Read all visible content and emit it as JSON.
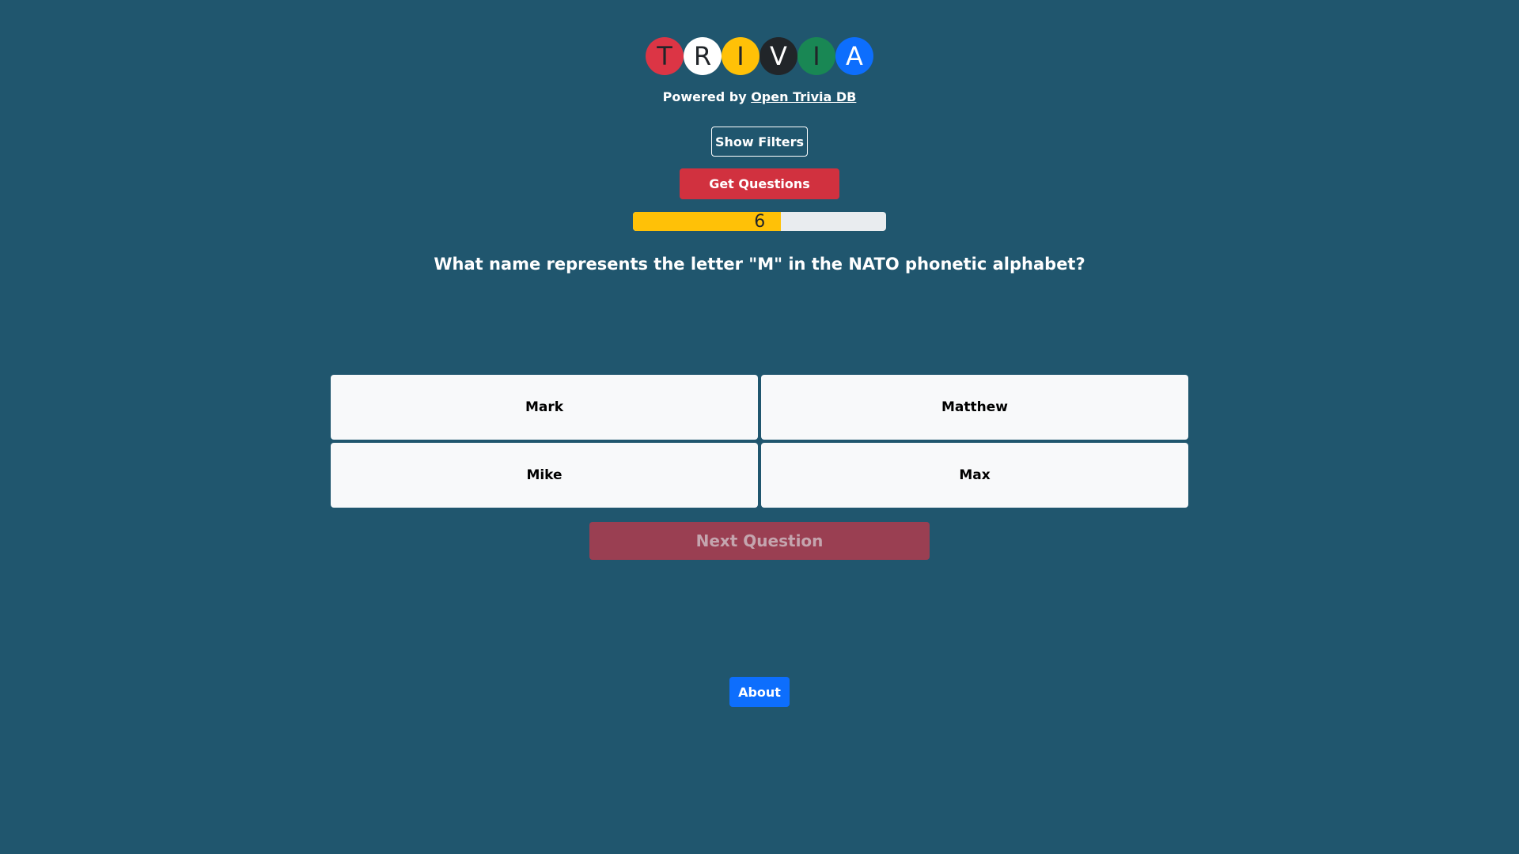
{
  "logo": {
    "letters": [
      {
        "char": "T",
        "bg": "#dc3545",
        "fg": "#212529"
      },
      {
        "char": "R",
        "bg": "#ffffff",
        "fg": "#212529"
      },
      {
        "char": "I",
        "bg": "#ffc107",
        "fg": "#212529"
      },
      {
        "char": "V",
        "bg": "#212529",
        "fg": "#ffffff"
      },
      {
        "char": "I",
        "bg": "#198754",
        "fg": "#212529"
      },
      {
        "char": "A",
        "bg": "#0d6efd",
        "fg": "#ffffff"
      }
    ]
  },
  "powered": {
    "prefix": "Powered by",
    "link_text": "Open Trivia DB"
  },
  "buttons": {
    "show_filters": "Show Filters",
    "get_questions": "Get Questions",
    "next_question": "Next Question",
    "about": "About"
  },
  "progress": {
    "label": "6",
    "fraction": 0.585
  },
  "question": {
    "text": "What name represents the letter \"M\" in the NATO phonetic alphabet?"
  },
  "answers": [
    "Mark",
    "Matthew",
    "Mike",
    "Max"
  ],
  "colors": {
    "background": "#20566e",
    "danger": "#d1313f",
    "warning": "#ffc107",
    "primary": "#0d6efd"
  }
}
